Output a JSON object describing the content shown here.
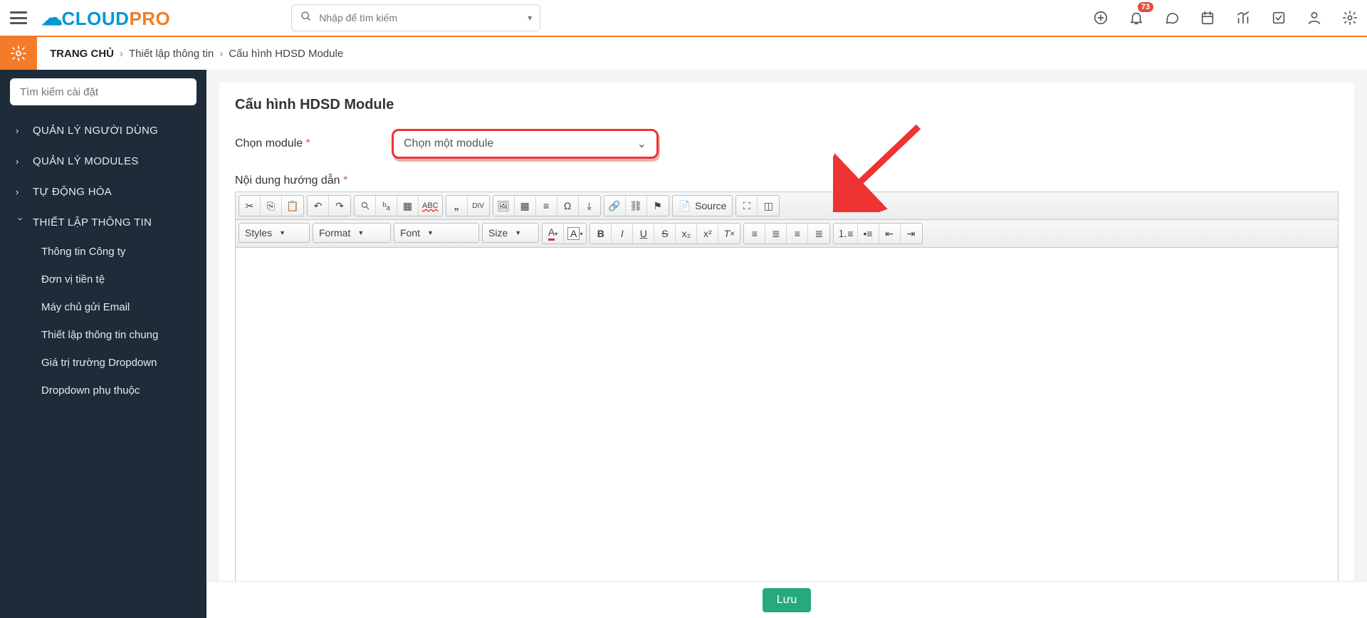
{
  "header": {
    "search_placeholder": "Nhập để tìm kiếm",
    "notification_count": "73"
  },
  "breadcrumb": {
    "home": "TRANG CHỦ",
    "lvl1": "Thiết lập thông tin",
    "lvl2": "Cấu hình HDSD Module"
  },
  "sidebar": {
    "search_placeholder": "Tìm kiếm cài đặt",
    "groups": [
      {
        "label": "QUẢN LÝ NGƯỜI DÙNG",
        "expanded": false
      },
      {
        "label": "QUẢN LÝ MODULES",
        "expanded": false
      },
      {
        "label": "TỰ ĐỘNG HÓA",
        "expanded": false
      },
      {
        "label": "THIẾT LẬP THÔNG TIN",
        "expanded": true
      }
    ],
    "subitems": [
      "Thông tin Công ty",
      "Đơn vị tiền tệ",
      "Máy chủ gửi Email",
      "Thiết lập thông tin chung",
      "Giá trị trường Dropdown",
      "Dropdown phụ thuộc"
    ]
  },
  "page": {
    "title": "Cấu hình HDSD Module",
    "module_label": "Chọn module",
    "module_placeholder": "Chọn một module",
    "content_label": "Nội dung hướng dẫn"
  },
  "editor_dropdowns": {
    "styles": "Styles",
    "format": "Format",
    "font": "Font",
    "size": "Size"
  },
  "editor_source": "Source",
  "footer": {
    "save": "Lưu"
  }
}
